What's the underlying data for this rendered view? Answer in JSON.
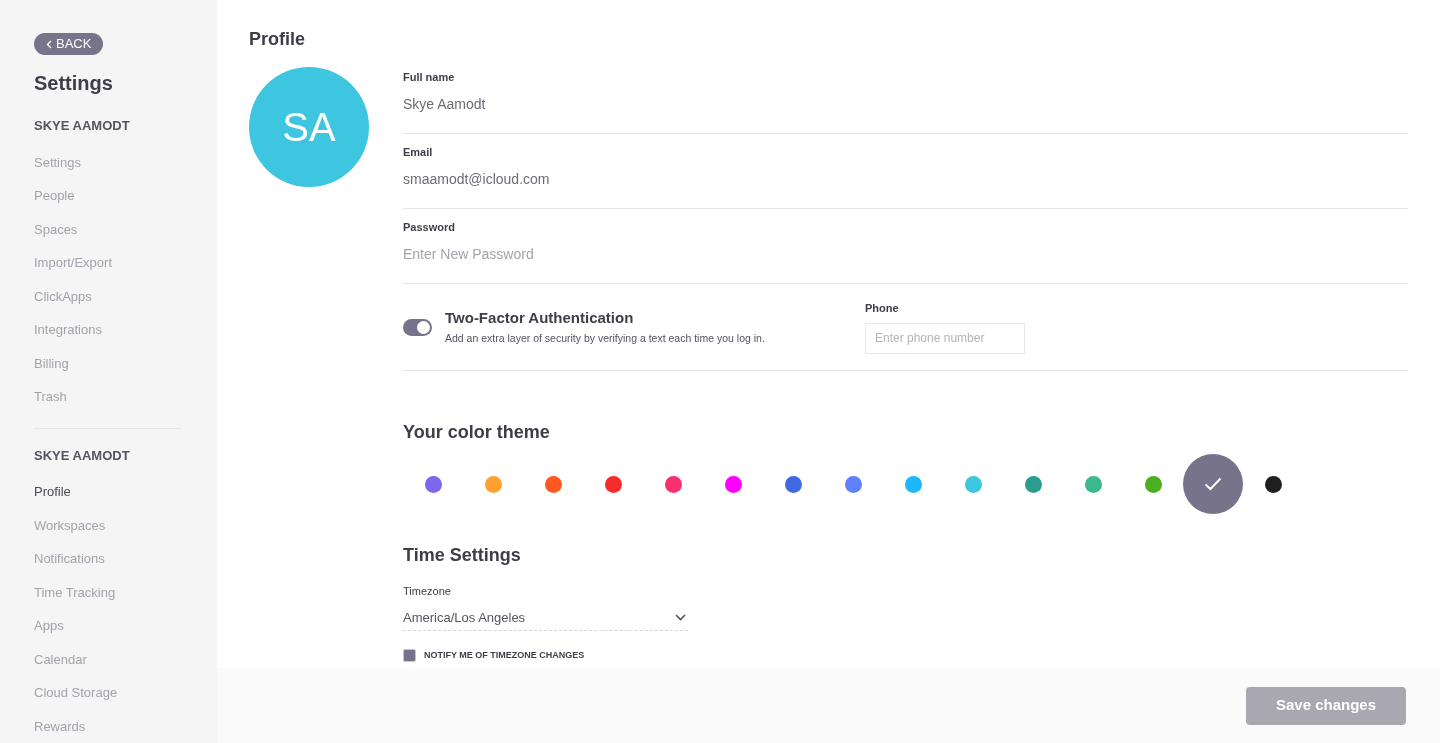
{
  "sidebar": {
    "back_button": "BACK",
    "title": "Settings",
    "sections": [
      {
        "heading": "SKYE AAMODT",
        "items": [
          {
            "label": "Settings",
            "selected": false
          },
          {
            "label": "People",
            "selected": false
          },
          {
            "label": "Spaces",
            "selected": false
          },
          {
            "label": "Import/Export",
            "selected": false
          },
          {
            "label": "ClickApps",
            "selected": false
          },
          {
            "label": "Integrations",
            "selected": false
          },
          {
            "label": "Billing",
            "selected": false
          },
          {
            "label": "Trash",
            "selected": false
          }
        ]
      },
      {
        "heading": "SKYE AAMODT",
        "items": [
          {
            "label": "Profile",
            "selected": true
          },
          {
            "label": "Workspaces",
            "selected": false
          },
          {
            "label": "Notifications",
            "selected": false
          },
          {
            "label": "Time Tracking",
            "selected": false
          },
          {
            "label": "Apps",
            "selected": false
          },
          {
            "label": "Calendar",
            "selected": false
          },
          {
            "label": "Cloud Storage",
            "selected": false
          },
          {
            "label": "Rewards",
            "selected": false
          }
        ]
      }
    ]
  },
  "profile": {
    "title": "Profile",
    "avatar_initials": "SA",
    "fields": [
      {
        "label": "Full name",
        "value": "Skye Aamodt"
      },
      {
        "label": "Email",
        "value": "smaamodt@icloud.com"
      },
      {
        "label": "Password",
        "placeholder": "Enter New Password"
      }
    ],
    "two_factor": {
      "on": true,
      "title": "Two-Factor Authentication",
      "description": "Add an extra layer of security by verifying a text each time you log in.",
      "phone_label": "Phone",
      "phone_placeholder": "Enter phone number"
    }
  },
  "color_theme": {
    "title": "Your color theme",
    "colors": [
      {
        "color": "#7b68ee",
        "selected": false
      },
      {
        "color": "#ffa12f",
        "selected": false
      },
      {
        "color": "#ff5722",
        "selected": false
      },
      {
        "color": "#f42c2c",
        "selected": false
      },
      {
        "color": "#f8306d",
        "selected": false
      },
      {
        "color": "#ff00fc",
        "selected": false
      },
      {
        "color": "#4169e1",
        "selected": false
      },
      {
        "color": "#5f81ff",
        "selected": false
      },
      {
        "color": "#1db7fd",
        "selected": false
      },
      {
        "color": "#3ec6e0",
        "selected": false
      },
      {
        "color": "#2a9d8f",
        "selected": false
      },
      {
        "color": "#3db88b",
        "selected": false
      },
      {
        "color": "#4caf21",
        "selected": false
      },
      {
        "color": "#77738a",
        "selected": true
      },
      {
        "color": "#202020",
        "selected": false
      }
    ]
  },
  "time_settings": {
    "title": "Time Settings",
    "timezone_label": "Timezone",
    "timezone": "America/Los Angeles",
    "notify": {
      "label": "NOTIFY ME OF TIMEZONE CHANGES",
      "checked": true
    }
  },
  "save_button": "Save changes"
}
